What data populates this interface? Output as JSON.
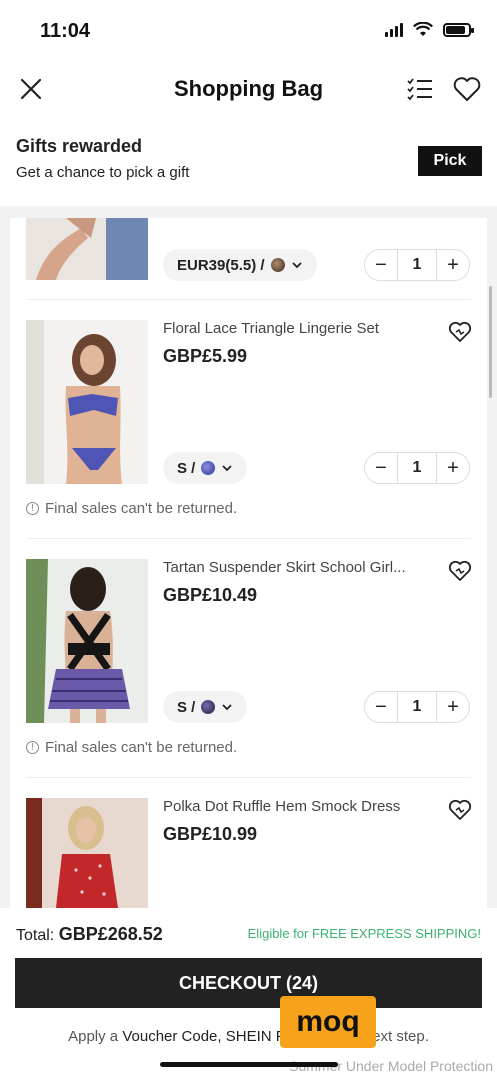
{
  "status": {
    "time": "11:04"
  },
  "nav": {
    "title": "Shopping Bag"
  },
  "gift": {
    "title": "Gifts rewarded",
    "subtitle": "Get a chance to pick a gift",
    "pick_label": "Pick"
  },
  "items": [
    {
      "name": "",
      "price": "",
      "size_label": "EUR39(5.5) /",
      "qty": "1",
      "note": ""
    },
    {
      "name": "Floral Lace Triangle Lingerie Set",
      "price": "GBP£5.99",
      "size_label": "S /",
      "qty": "1",
      "note": "Final sales can't be returned."
    },
    {
      "name": "Tartan Suspender Skirt School Girl...",
      "price": "GBP£10.49",
      "size_label": "S /",
      "qty": "1",
      "note": "Final sales can't be returned."
    },
    {
      "name": "Polka Dot Ruffle Hem Smock Dress",
      "price": "GBP£10.99",
      "size_label": "",
      "qty": "",
      "note": ""
    }
  ],
  "footer": {
    "total_label": "Total:",
    "total_value": "GBP£268.52",
    "shipping_note": "Eligible for FREE EXPRESS SHIPPING!",
    "checkout_label": "CHECKOUT (24)",
    "voucher_prefix": "Apply a",
    "voucher_strong": "Voucher Code, SHEIN P",
    "voucher_suffix": "next step.",
    "badge_text": "moq",
    "watermark": "Summer Under Model Protection"
  },
  "colors": {
    "accent": "#222222",
    "free_shipping": "#3cb371",
    "badge": "#f7a21b"
  }
}
